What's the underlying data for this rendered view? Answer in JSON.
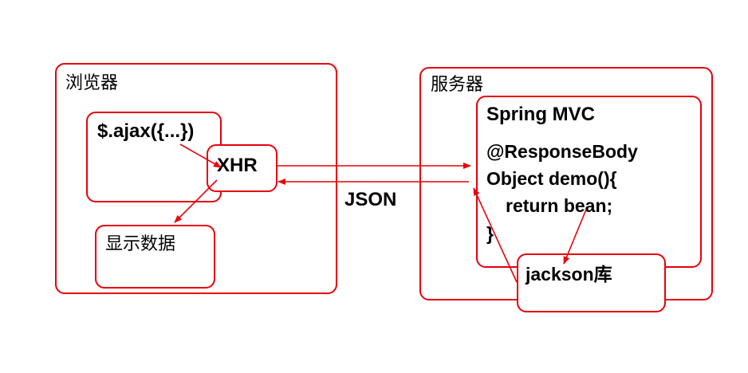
{
  "browser": {
    "title": "浏览器",
    "ajax_label": "$.ajax({...})",
    "xhr_label": "XHR",
    "display_label": "显示数据"
  },
  "connection": {
    "json_label": "JSON"
  },
  "server": {
    "title": "服务器",
    "spring_title": "Spring MVC",
    "code_lines": [
      "@ResponseBody",
      "Object demo(){",
      "return bean;",
      "}"
    ],
    "jackson_label": "jackson库"
  },
  "colors": {
    "border": "#e8000b",
    "arrow": "#e8000b",
    "text": "#000000",
    "background": "#ffffff"
  }
}
